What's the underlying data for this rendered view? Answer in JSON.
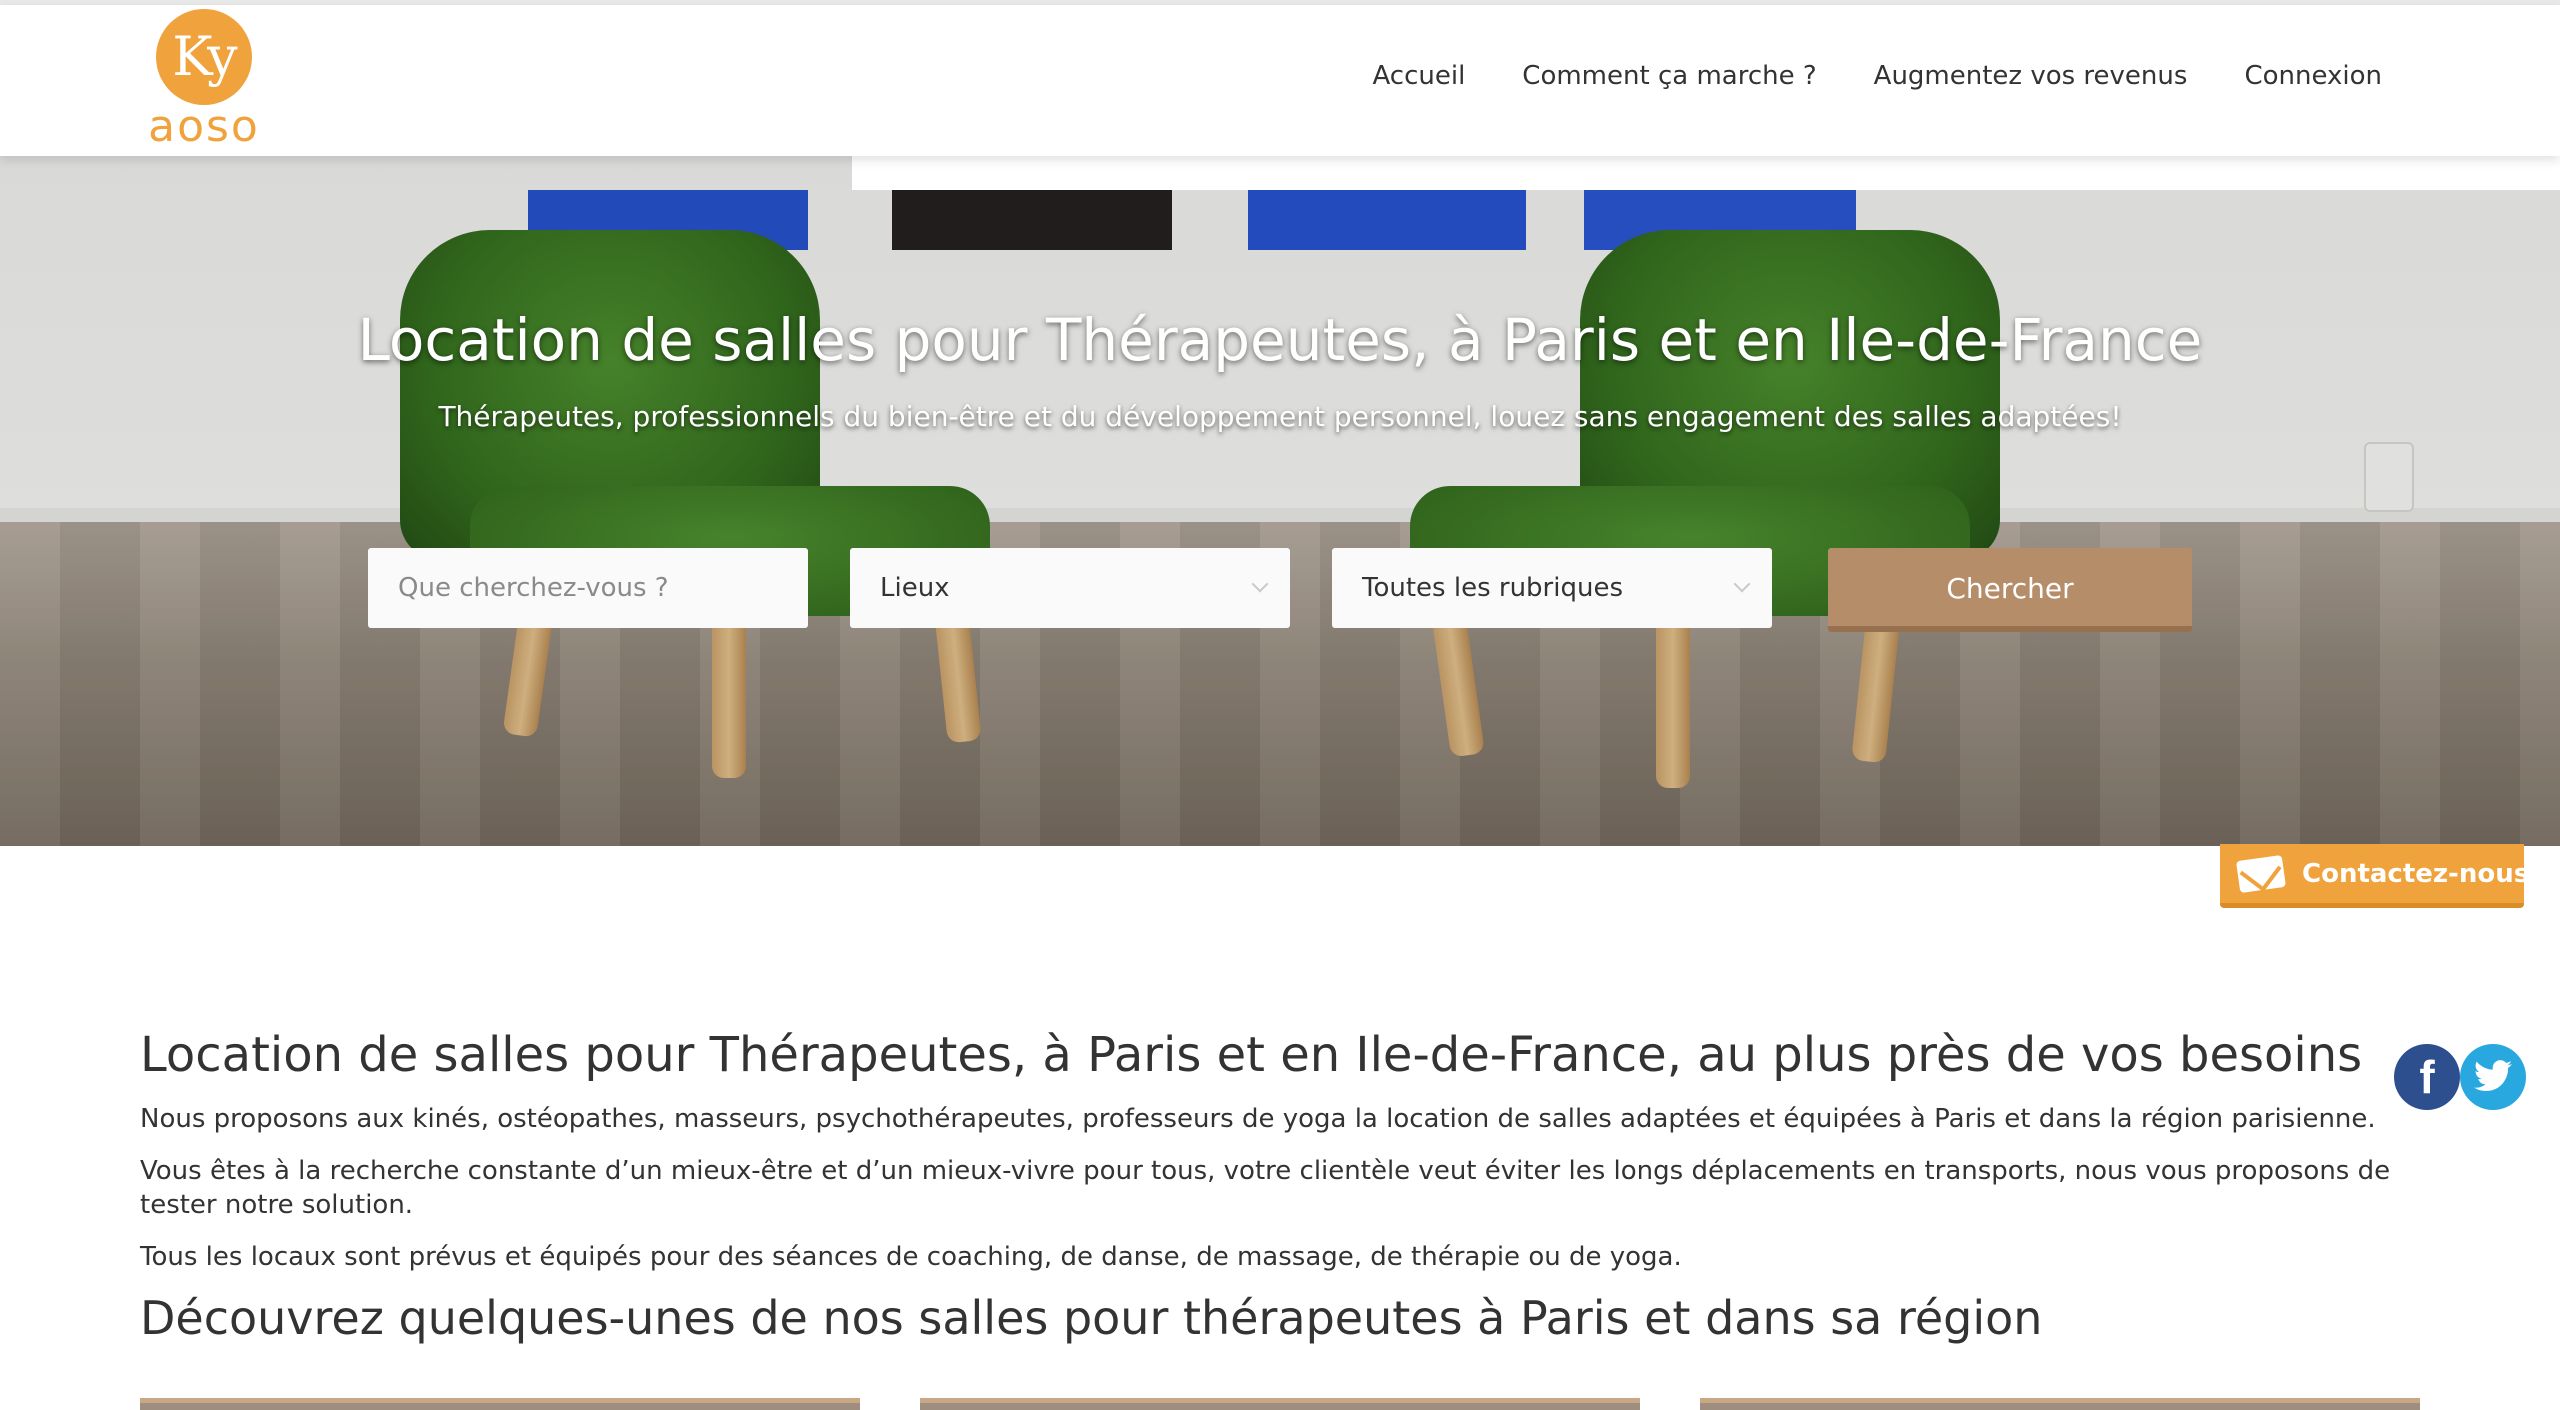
{
  "header": {
    "logo": {
      "ky": "Ky",
      "word": "aoso"
    },
    "nav": [
      "Accueil",
      "Comment ça marche ?",
      "Augmentez vos revenus",
      "Connexion"
    ]
  },
  "hero": {
    "title": "Location de salles pour Thérapeutes, à Paris et en Ile-de-France",
    "subtitle": "Thérapeutes, professionnels du bien-être et du développement personnel, louez sans engagement des salles adaptées!",
    "search": {
      "placeholder": "Que cherchez-vous ?",
      "lieux": "Lieux",
      "rubriques": "Toutes les rubriques",
      "button": "Chercher"
    }
  },
  "contact": {
    "label": "Contactez-nous"
  },
  "social": {
    "facebook": "f"
  },
  "content": {
    "heading": "Location de salles pour Thérapeutes, à Paris et en Ile-de-France, au plus près de vos besoins",
    "paragraphs": [
      "Nous proposons aux kinés, ostéopathes, masseurs, psychothérapeutes, professeurs de yoga la location de salles adaptées et équipées à Paris et dans la région parisienne.",
      "Vous êtes à la recherche constante d’un mieux-être et d’un mieux-vivre pour tous, votre clientèle veut éviter les longs déplacements en transports, nous vous proposons de tester notre solution.",
      "Tous les locaux sont prévus et équipés pour des séances de coaching, de danse, de massage, de thérapie ou de yoga."
    ],
    "subheading": "Découvrez quelques-unes de nos salles pour thérapeutes à Paris et dans sa région"
  },
  "colors": {
    "brand_orange": "#f0a33c",
    "search_button": "#b68d69",
    "facebook": "#2d4f8e",
    "twitter": "#29a8e0",
    "chair_green": "#356f1f"
  }
}
